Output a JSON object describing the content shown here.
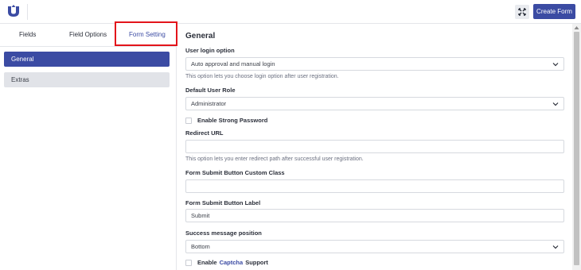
{
  "header": {
    "logo_icon": "user-registration-logo-icon",
    "fullscreen_icon": "fullscreen-icon",
    "create_button": "Create Form"
  },
  "sidebar": {
    "tabs": [
      {
        "label": "Fields"
      },
      {
        "label": "Field Options"
      },
      {
        "label": "Form Setting"
      }
    ],
    "items": [
      {
        "label": "General"
      },
      {
        "label": "Extras"
      }
    ]
  },
  "main": {
    "section_title": "General",
    "login_option": {
      "label": "User login option",
      "value": "Auto approval and manual login",
      "help": "This option lets you choose login option after user registration."
    },
    "default_role": {
      "label": "Default User Role",
      "value": "Administrator"
    },
    "strong_password": {
      "label": "Enable Strong Password"
    },
    "redirect_url": {
      "label": "Redirect URL",
      "value": "",
      "help": "This option lets you enter redirect path after successful user registration."
    },
    "custom_class": {
      "label": "Form Submit Button Custom Class",
      "value": ""
    },
    "button_label": {
      "label": "Form Submit Button Label",
      "value": "Submit"
    },
    "message_position": {
      "label": "Success message position",
      "value": "Bottom"
    },
    "captcha": {
      "prefix": "Enable",
      "link": "Captcha",
      "suffix": "Support"
    }
  },
  "colors": {
    "accent": "#3b4ba3",
    "highlight_border": "#e3141b",
    "inactive_item": "#e1e3e8"
  }
}
